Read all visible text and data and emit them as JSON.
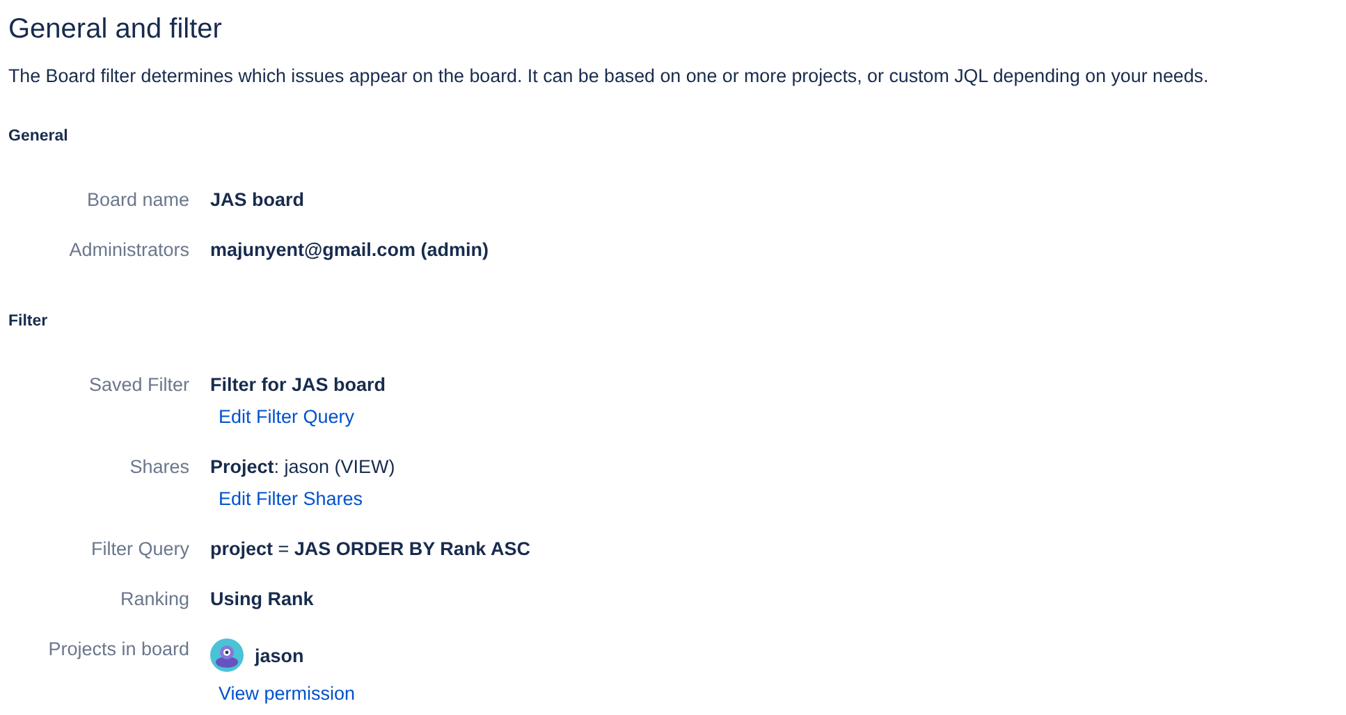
{
  "title": "General and filter",
  "description": "The Board filter determines which issues appear on the board. It can be based on one or more projects, or custom JQL depending on your needs.",
  "sections": [
    {
      "title": "General",
      "rows": [
        {
          "label": "Board name",
          "value": "**JAS board**"
        },
        {
          "label": "Administrators",
          "value": "**majunyent@gmail.com (admin)**"
        }
      ]
    },
    {
      "title": "Filter",
      "rows": [
        {
          "label": "Saved Filter",
          "value": "**Filter for JAS board**",
          "link": "Edit Filter Query"
        },
        {
          "label": "Shares",
          "value": "**Project**: jason (VIEW)",
          "link": "Edit Filter Shares"
        },
        {
          "label": "Filter Query",
          "value": "**project** = **JAS ORDER BY Rank ASC**"
        },
        {
          "label": "Ranking",
          "value": "**Using Rank**"
        },
        {
          "label": "Projects in board",
          "value": "**jason**",
          "avatar": true,
          "link": "View permission"
        }
      ]
    }
  ]
}
